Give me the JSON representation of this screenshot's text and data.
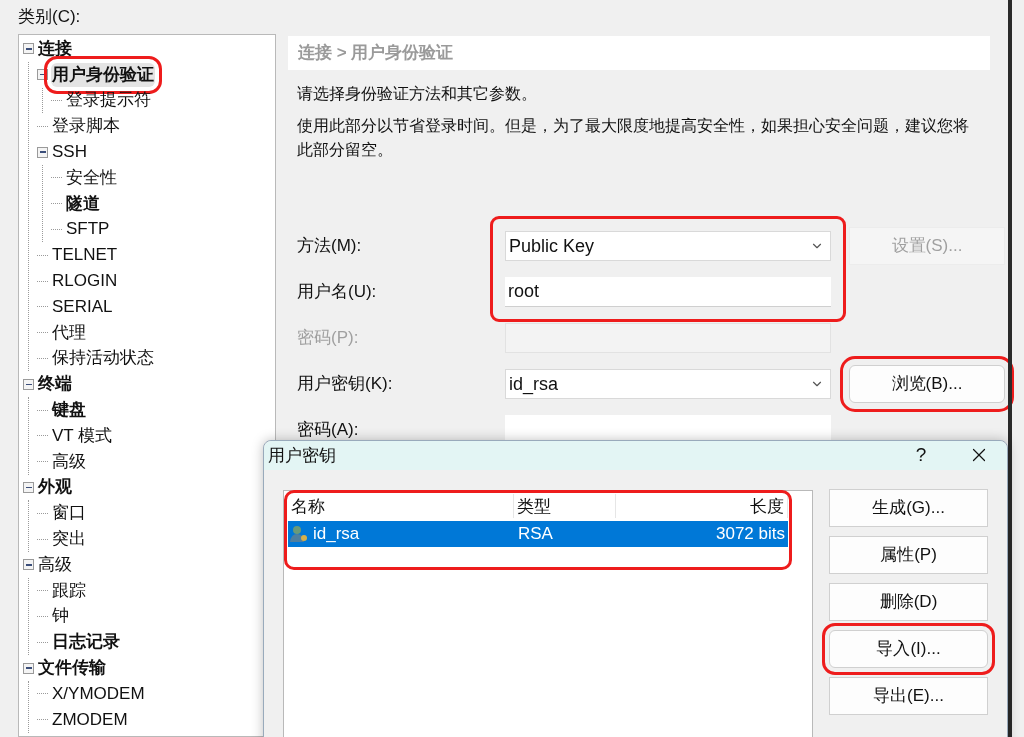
{
  "category_label": "类别(C):",
  "tree": [
    {
      "label": "连接",
      "bold": true,
      "expanded": true,
      "selected": false,
      "annotated": false,
      "children": [
        {
          "label": "用户身份验证",
          "bold": true,
          "expanded": true,
          "selected": true,
          "annotated": true,
          "children": [
            {
              "label": "登录提示符",
              "bold": false,
              "selected": false,
              "annotated": false
            }
          ]
        },
        {
          "label": "登录脚本",
          "bold": false,
          "selected": false,
          "annotated": false
        },
        {
          "label": "SSH",
          "bold": false,
          "expanded": true,
          "selected": false,
          "annotated": false,
          "children": [
            {
              "label": "安全性",
              "bold": false,
              "selected": false,
              "annotated": false
            },
            {
              "label": "隧道",
              "bold": true,
              "selected": false,
              "annotated": false
            },
            {
              "label": "SFTP",
              "bold": false,
              "selected": false,
              "annotated": false
            }
          ]
        },
        {
          "label": "TELNET",
          "bold": false,
          "selected": false,
          "annotated": false
        },
        {
          "label": "RLOGIN",
          "bold": false,
          "selected": false,
          "annotated": false
        },
        {
          "label": "SERIAL",
          "bold": false,
          "selected": false,
          "annotated": false
        },
        {
          "label": "代理",
          "bold": false,
          "selected": false,
          "annotated": false
        },
        {
          "label": "保持活动状态",
          "bold": false,
          "selected": false,
          "annotated": false
        }
      ]
    },
    {
      "label": "终端",
      "bold": true,
      "expanded": true,
      "selected": false,
      "annotated": false,
      "children": [
        {
          "label": "键盘",
          "bold": true,
          "selected": false,
          "annotated": false
        },
        {
          "label": "VT 模式",
          "bold": false,
          "selected": false,
          "annotated": false
        },
        {
          "label": "高级",
          "bold": false,
          "selected": false,
          "annotated": false
        }
      ]
    },
    {
      "label": "外观",
      "bold": true,
      "expanded": true,
      "selected": false,
      "annotated": false,
      "children": [
        {
          "label": "窗口",
          "bold": false,
          "selected": false,
          "annotated": false
        },
        {
          "label": "突出",
          "bold": false,
          "selected": false,
          "annotated": false
        }
      ]
    },
    {
      "label": "高级",
      "bold": false,
      "expanded": true,
      "selected": false,
      "annotated": false,
      "children": [
        {
          "label": "跟踪",
          "bold": false,
          "selected": false,
          "annotated": false
        },
        {
          "label": "钟",
          "bold": false,
          "selected": false,
          "annotated": false
        },
        {
          "label": "日志记录",
          "bold": true,
          "selected": false,
          "annotated": false
        }
      ]
    },
    {
      "label": "文件传输",
      "bold": true,
      "expanded": true,
      "selected": false,
      "annotated": false,
      "children": [
        {
          "label": "X/YMODEM",
          "bold": false,
          "selected": false,
          "annotated": false
        },
        {
          "label": "ZMODEM",
          "bold": false,
          "selected": false,
          "annotated": false
        }
      ]
    }
  ],
  "breadcrumb": "连接 > 用户身份验证",
  "descriptions": [
    "请选择身份验证方法和其它参数。",
    "使用此部分以节省登录时间。但是，为了最大限度地提高安全性，如果担心安全问题，建议您将此部分留空。"
  ],
  "fields": [
    {
      "label": "方法(M):",
      "kind": "dropdown",
      "value": "Public Key",
      "disabled": false,
      "annotated": true,
      "button": {
        "label": "设置(S)...",
        "disabled": true,
        "annotated": false
      }
    },
    {
      "label": "用户名(U):",
      "kind": "text",
      "value": "root",
      "disabled": false,
      "annotated": true
    },
    {
      "label": "密码(P):",
      "kind": "text",
      "disabled": true,
      "annotated": false
    },
    {
      "label": "用户密钥(K):",
      "kind": "dropdown",
      "value": "id_rsa",
      "disabled": false,
      "annotated": false,
      "button": {
        "label": "浏览(B)...",
        "disabled": false,
        "annotated": true
      }
    },
    {
      "label": "密码(A):",
      "kind": "text",
      "disabled": false,
      "annotated": false
    }
  ],
  "dialog": {
    "title": "用户密钥",
    "help": "?",
    "key_list": {
      "annotated": true,
      "columns": [
        "名称",
        "类型",
        "长度"
      ],
      "rows": [
        {
          "cells": [
            "id_rsa",
            "RSA",
            "3072 bits"
          ],
          "selected": true
        }
      ]
    },
    "buttons": [
      {
        "label": "生成(G)...",
        "annotated": false
      },
      {
        "label": "属性(P)",
        "annotated": false
      },
      {
        "label": "删除(D)",
        "annotated": false
      },
      {
        "label": "导入(I)...",
        "annotated": true
      },
      {
        "label": "导出(E)...",
        "annotated": false
      }
    ]
  }
}
